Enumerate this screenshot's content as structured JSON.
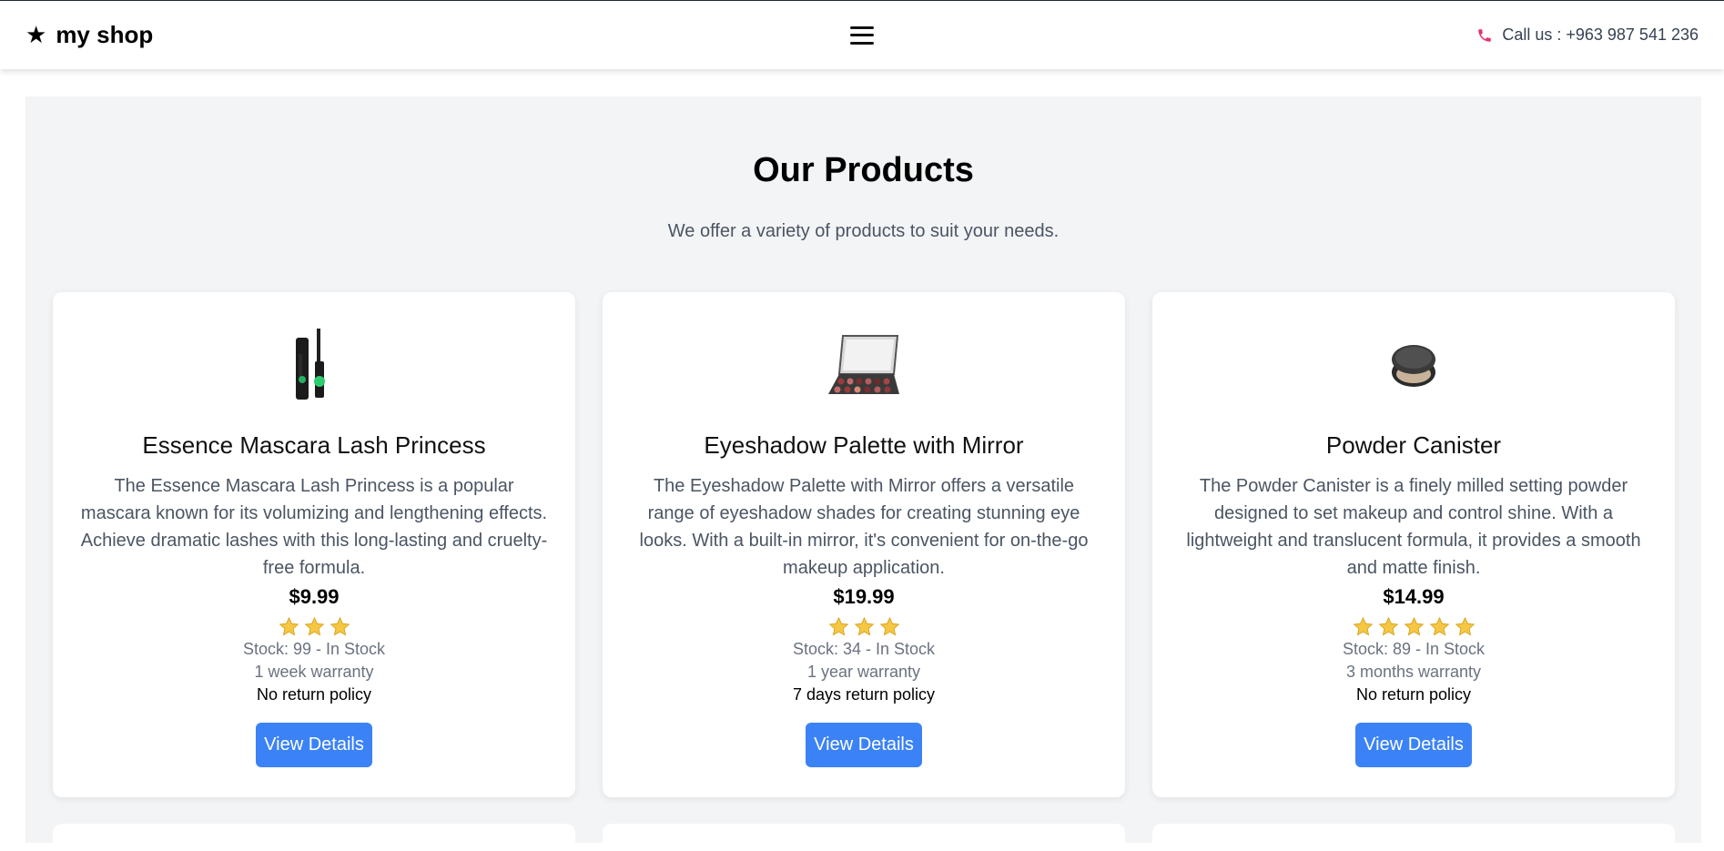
{
  "navbar": {
    "brand": "my shop",
    "brand_icon": "star-icon",
    "menu_icon": "hamburger-icon",
    "call_label": "Call us : +963 987 541 236",
    "call_icon": "phone-icon",
    "call_icon_color": "#e6336b"
  },
  "hero": {
    "title": "Our Products",
    "subtitle": "We offer a variety of products to suit your needs."
  },
  "colors": {
    "accent": "#3b82f6",
    "star": "#f6c744",
    "section_bg": "#f3f4f6"
  },
  "products": [
    {
      "image_icon": "mascara-image",
      "title": "Essence Mascara Lash Princess",
      "description": "The Essence Mascara Lash Princess is a popular mascara known for its volumizing and lengthening effects. Achieve dramatic lashes with this long-lasting and cruelty-free formula.",
      "price": "$9.99",
      "rating": 3,
      "stock": "Stock: 99 - In Stock",
      "warranty": "1 week warranty",
      "return_policy": "No return policy",
      "button": "View Details"
    },
    {
      "image_icon": "eyeshadow-palette-image",
      "title": "Eyeshadow Palette with Mirror",
      "description": "The Eyeshadow Palette with Mirror offers a versatile range of eyeshadow shades for creating stunning eye looks. With a built-in mirror, it's convenient for on-the-go makeup application.",
      "price": "$19.99",
      "rating": 3,
      "stock": "Stock: 34 - In Stock",
      "warranty": "1 year warranty",
      "return_policy": "7 days return policy",
      "button": "View Details"
    },
    {
      "image_icon": "powder-canister-image",
      "title": "Powder Canister",
      "description": "The Powder Canister is a finely milled setting powder designed to set makeup and control shine. With a lightweight and translucent formula, it provides a smooth and matte finish.",
      "price": "$14.99",
      "rating": 5,
      "stock": "Stock: 89 - In Stock",
      "warranty": "3 months warranty",
      "return_policy": "No return policy",
      "button": "View Details"
    }
  ]
}
